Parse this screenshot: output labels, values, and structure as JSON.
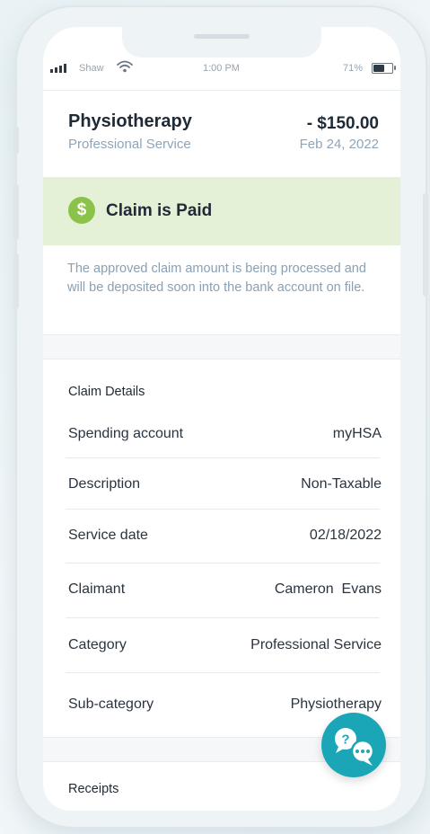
{
  "status_bar": {
    "carrier": "Shaw",
    "time": "1:00 PM",
    "battery_pct": "71%",
    "battery_level": 0.71
  },
  "claim": {
    "title": "Physiotherapy",
    "subtitle": "Professional Service",
    "amount": "- $150.00",
    "date": "Feb 24, 2022"
  },
  "status": {
    "label": "Claim is Paid",
    "icon": "dollar-circle-icon",
    "icon_glyph": "$",
    "color": "#8bc34a",
    "banner_bg": "#e4f1d7",
    "message": "The approved claim amount is being processed and will be deposited soon into the bank account on file."
  },
  "details": {
    "title": "Claim Details",
    "rows": [
      {
        "label": "Spending account",
        "value": "myHSA"
      },
      {
        "label": "Description",
        "value": "Non-Taxable"
      },
      {
        "label": "Service date",
        "value": "02/18/2022"
      },
      {
        "label": "Claimant",
        "value": "Cameron  Evans"
      },
      {
        "label": "Category",
        "value": "Professional Service"
      },
      {
        "label": "Sub-category",
        "value": "Physiotherapy"
      }
    ]
  },
  "receipts": {
    "title": "Receipts"
  },
  "chat": {
    "icon": "help-chat-icon",
    "color": "#1aa6b7"
  }
}
